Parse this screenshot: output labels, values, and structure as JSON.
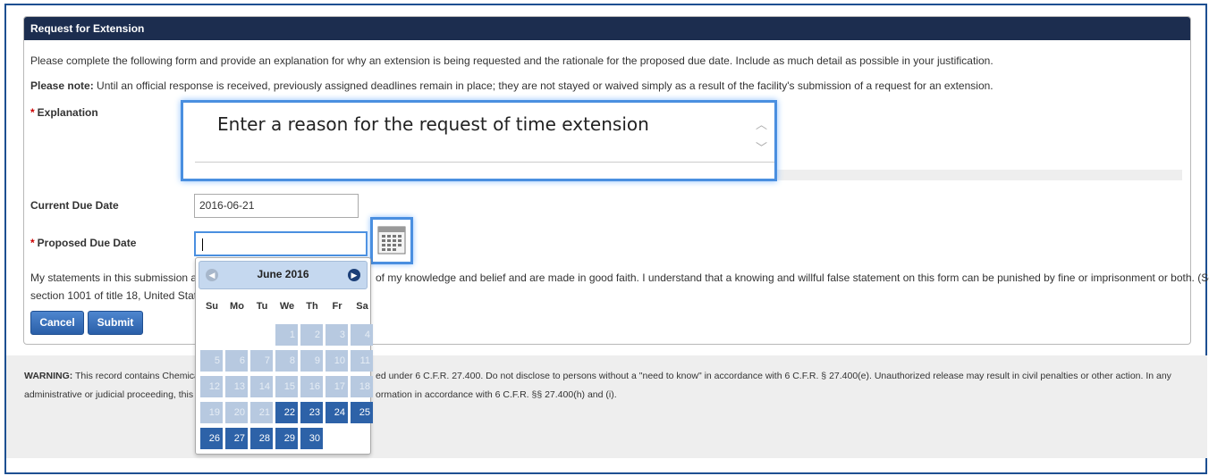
{
  "panel": {
    "title": "Request for Extension",
    "intro": "Please complete the following form and provide an explanation for why an extension is being requested and the rationale for the proposed due date. Include as much detail as possible in your justification.",
    "note_label": "Please note:",
    "note_text": " Until an official response is received, previously assigned deadlines remain in place; they are not stayed or waived simply as a result of the facility's submission of a request for an extension."
  },
  "form": {
    "required_marker": "*",
    "explanation_label": "Explanation",
    "explanation_placeholder": "Enter a reason for the request of time extension",
    "current_due_label": "Current Due Date",
    "current_due_value": "2016-06-21",
    "proposed_due_label": "Proposed Due Date",
    "proposed_due_value": "",
    "statement_line1_a": "My statements in this submission are",
    "statement_line1_b": "of my knowledge and belief and are made in good faith. I understand that a knowing and willful false statement on this form can be punished by fine or imprisonment or both. (See",
    "statement_line2": "section 1001 of title 18, United States",
    "cancel_label": "Cancel",
    "submit_label": "Submit"
  },
  "warning": {
    "label": "WARNING:",
    "line1_a": " This record contains Chemica",
    "line1_b": "ed under 6 C.F.R. 27.400. Do not disclose to persons without a \"need to know\" in accordance with 6 C.F.R. § 27.400(e). Unauthorized release may result in civil penalties or other action. In any",
    "line2_a": "administrative or judicial proceeding, this i",
    "line2_b": "ormation in accordance with 6 C.F.R. §§ 27.400(h) and (i)."
  },
  "datepicker": {
    "title": "June 2016",
    "weekdays": [
      "Su",
      "Mo",
      "Tu",
      "We",
      "Th",
      "Fr",
      "Sa"
    ],
    "weeks": [
      [
        "",
        "",
        "",
        "1",
        "2",
        "3",
        "4"
      ],
      [
        "5",
        "6",
        "7",
        "8",
        "9",
        "10",
        "11"
      ],
      [
        "12",
        "13",
        "14",
        "15",
        "16",
        "17",
        "18"
      ],
      [
        "19",
        "20",
        "21",
        "22",
        "23",
        "24",
        "25"
      ],
      [
        "26",
        "27",
        "28",
        "29",
        "30",
        "",
        ""
      ]
    ],
    "first_selectable": "22",
    "colors": {
      "enabled": "#2d62a8",
      "disabled": "#b7c9e0",
      "header": "#c5d8ef"
    }
  },
  "colors": {
    "header_bar": "#1c2d4f",
    "focus": "#4a8fe0",
    "button": "#2a5fa8",
    "required": "#cc0000"
  }
}
